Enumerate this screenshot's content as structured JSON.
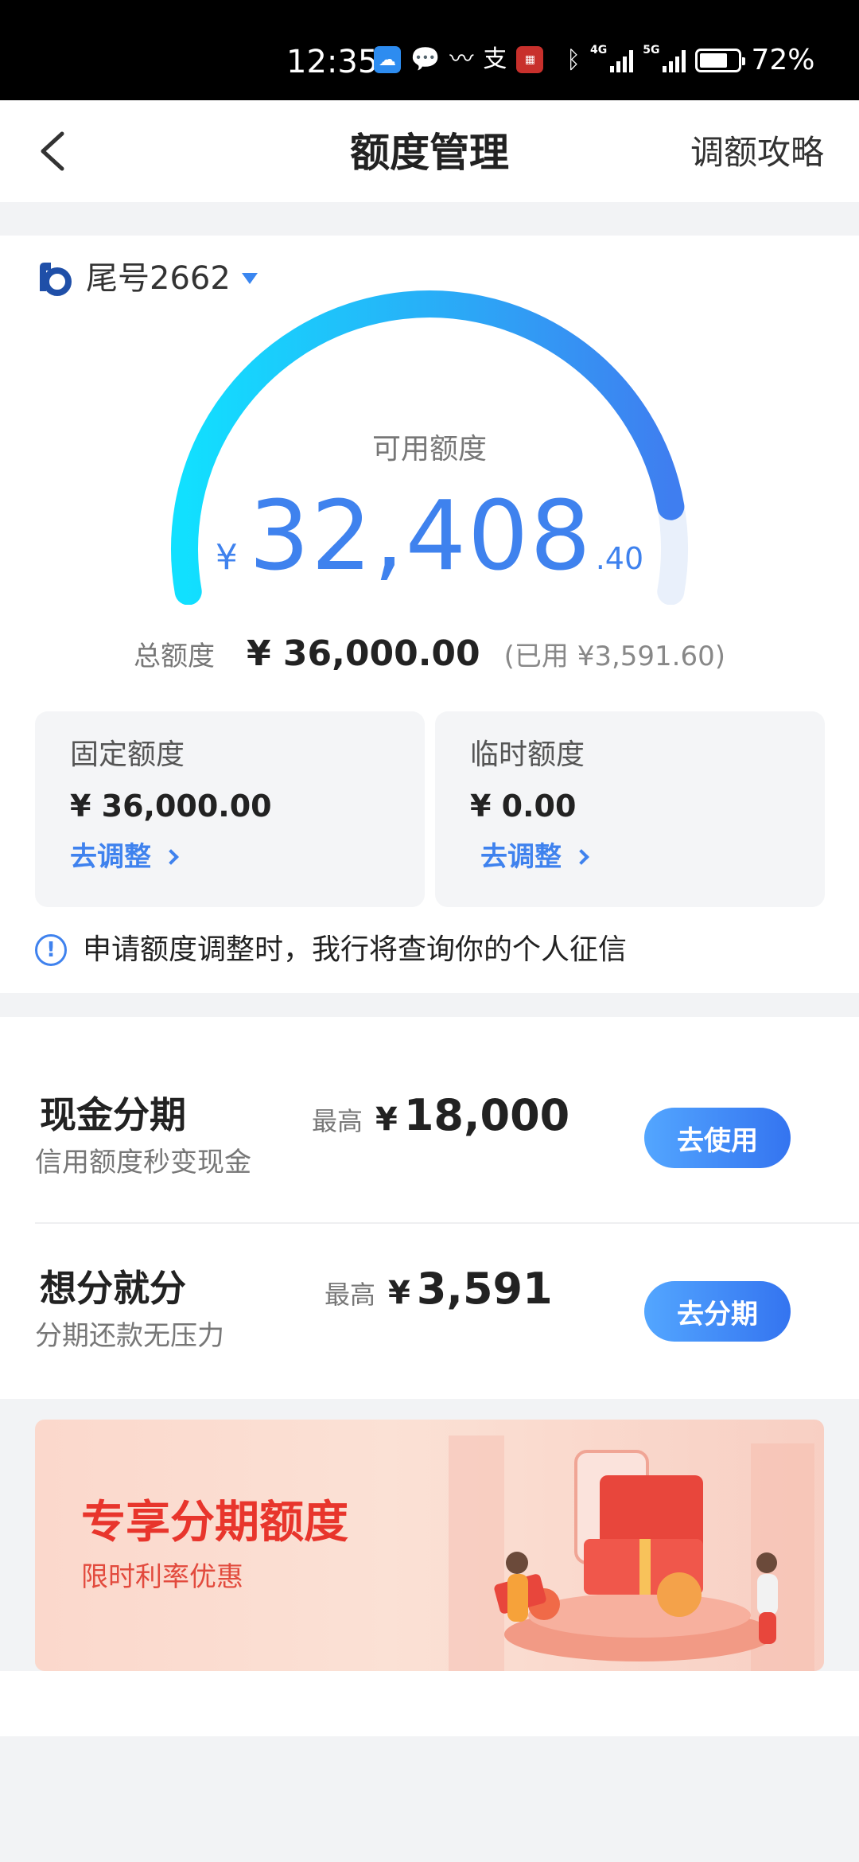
{
  "status_bar": {
    "time": "12:35",
    "network_1": "4G",
    "network_2": "5G",
    "battery": "72%",
    "battery_level": 0.72,
    "app_icons": [
      "weather-app-icon",
      "wechat-icon",
      "app-swoosh-icon",
      "alipay-icon",
      "news-app-icon",
      "bluetooth-icon"
    ]
  },
  "nav": {
    "title": "额度管理",
    "right_link": "调额攻略"
  },
  "card": {
    "label": "尾号2662"
  },
  "available": {
    "label": "可用额度",
    "currency": "¥",
    "integer": "32,408",
    "decimal": ".40",
    "used_fraction": 0.0998
  },
  "total": {
    "label": "总额度",
    "value": "¥ 36,000.00",
    "used": "(已用 ¥3,591.60)"
  },
  "fixed": {
    "title": "固定额度",
    "value": "¥ 36,000.00",
    "link": "去调整"
  },
  "temp": {
    "title": "临时额度",
    "value": "¥ 0.00",
    "link": "去调整"
  },
  "notice": "申请额度调整时，我行将查询你的个人征信",
  "offers": [
    {
      "title": "现金分期",
      "subtitle": "信用额度秒变现金",
      "max_label": "最高",
      "currency": "¥",
      "max_value": "18,000",
      "button": "去使用"
    },
    {
      "title": "想分就分",
      "subtitle": "分期还款无压力",
      "max_label": "最高",
      "currency": "¥",
      "max_value": "3,591",
      "button": "去分期"
    }
  ],
  "banner": {
    "title": "专享分期额度",
    "subtitle": "限时利率优惠"
  },
  "colors": {
    "accent": "#3f82ee",
    "gauge_start": "#11e0ff",
    "gauge_end": "#3f7ef0",
    "banner_title": "#e8352c"
  }
}
